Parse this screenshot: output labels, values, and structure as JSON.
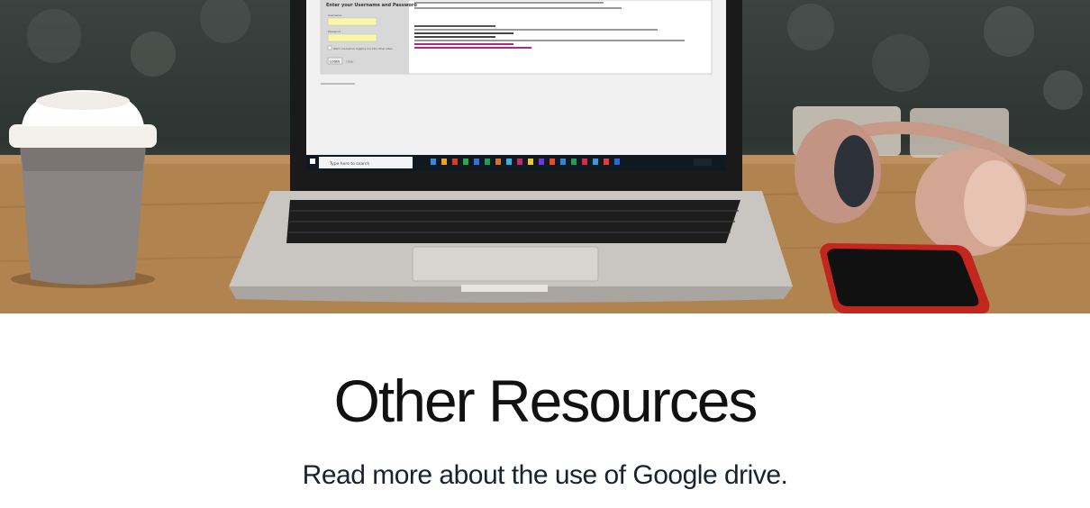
{
  "hero": {
    "login_box": {
      "title": "Enter your Username and Password",
      "username_label": "Username",
      "password_label": "Password",
      "remember_label": "Warn me before logging me into other sites.",
      "login_button": "LOGIN",
      "clear_button": "clear"
    },
    "taskbar": {
      "search_placeholder": "Type here to search"
    }
  },
  "section": {
    "title": "Other Resources",
    "subtitle": "Read more about the use of Google drive."
  }
}
